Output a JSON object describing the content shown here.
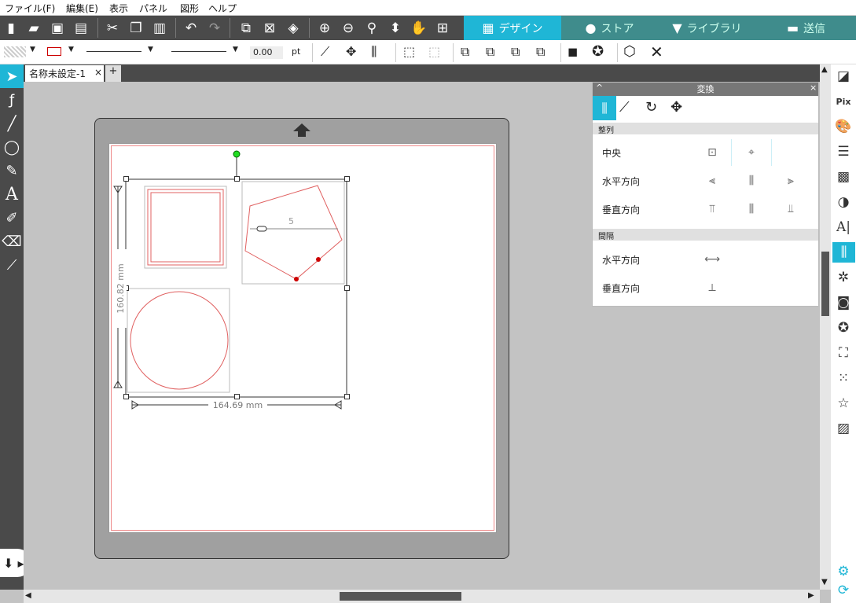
{
  "menu": [
    "ファイル(F)",
    "編集(E)",
    "表示",
    "パネル",
    "図形",
    "ヘルプ"
  ],
  "tabs": {
    "design": "デザイン",
    "store": "ストア",
    "library": "ライブラリ",
    "send": "送信"
  },
  "line_width": {
    "value": "0.00",
    "unit": "pt"
  },
  "document_tab": {
    "title": "名称未設定-1",
    "close": "×",
    "add": "+"
  },
  "panel": {
    "title": "変換",
    "close": "×",
    "collapse": "^",
    "align_section": "整列",
    "center_label": "中央",
    "horizontal_label": "水平方向",
    "vertical_label": "垂直方向",
    "spacing_section": "間隔",
    "spacing_horizontal_label": "水平方向",
    "spacing_vertical_label": "垂直方向"
  },
  "selection": {
    "height": "160.82 mm",
    "width": "164.69 mm",
    "ruler_mark": "5"
  },
  "colors": {
    "accent": "#1fb6d6",
    "toolbar": "#4a4a4a",
    "nav": "#3f8c8c",
    "cut_line": "#e06060"
  }
}
